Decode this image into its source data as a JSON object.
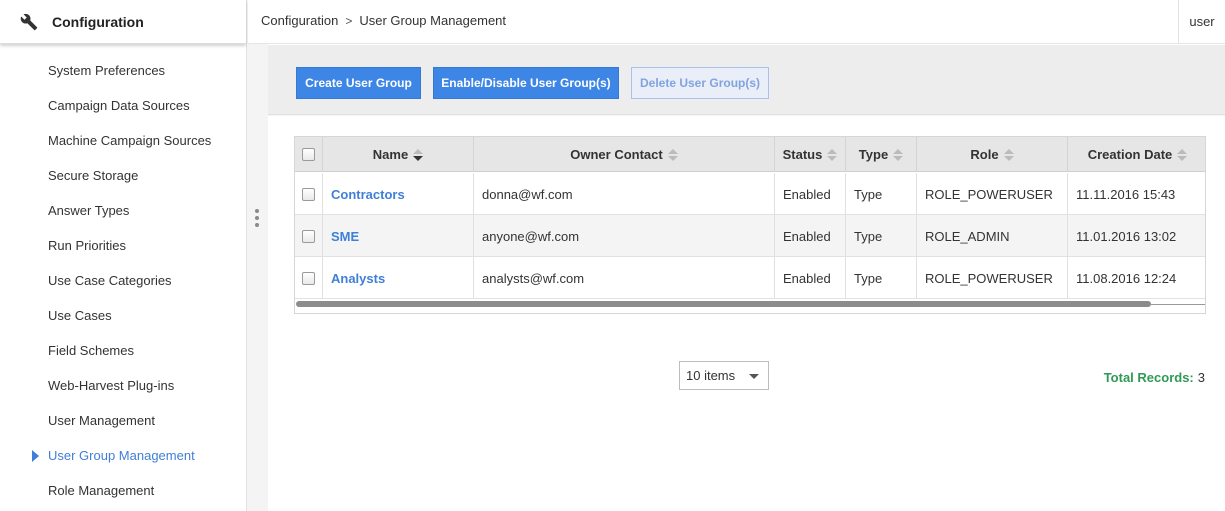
{
  "sidebar": {
    "title": "Configuration",
    "items": [
      {
        "label": "System Preferences",
        "active": false
      },
      {
        "label": "Campaign Data Sources",
        "active": false
      },
      {
        "label": "Machine Campaign Sources",
        "active": false
      },
      {
        "label": "Secure Storage",
        "active": false
      },
      {
        "label": "Answer Types",
        "active": false
      },
      {
        "label": "Run Priorities",
        "active": false
      },
      {
        "label": "Use Case Categories",
        "active": false
      },
      {
        "label": "Use Cases",
        "active": false
      },
      {
        "label": "Field Schemes",
        "active": false
      },
      {
        "label": "Web-Harvest Plug-ins",
        "active": false
      },
      {
        "label": "User Management",
        "active": false
      },
      {
        "label": "User Group Management",
        "active": true
      },
      {
        "label": "Role Management",
        "active": false
      }
    ]
  },
  "header": {
    "breadcrumb": [
      "Configuration",
      "User Group Management"
    ],
    "breadcrumb_separator": ">",
    "user": "user"
  },
  "toolbar": {
    "create_label": "Create User Group",
    "toggle_label": "Enable/Disable User Group(s)",
    "delete_label": "Delete User Group(s)"
  },
  "grid": {
    "columns": {
      "name": "Name",
      "owner": "Owner Contact",
      "status": "Status",
      "type": "Type",
      "role": "Role",
      "created": "Creation Date"
    },
    "rows": [
      {
        "name": "Contractors",
        "owner": "donna@wf.com",
        "status": "Enabled",
        "type": "Type",
        "role": "ROLE_POWERUSER",
        "created": "11.11.2016 15:43"
      },
      {
        "name": "SME",
        "owner": "anyone@wf.com",
        "status": "Enabled",
        "type": "Type",
        "role": "ROLE_ADMIN",
        "created": "11.01.2016 13:02"
      },
      {
        "name": "Analysts",
        "owner": "analysts@wf.com",
        "status": "Enabled",
        "type": "Type",
        "role": "ROLE_POWERUSER",
        "created": "11.08.2016 12:24"
      }
    ]
  },
  "pager": {
    "page_size": "10 items"
  },
  "summary": {
    "total_label": "Total Records:",
    "total_value": "3"
  },
  "colors": {
    "accent": "#3f7fd8",
    "primary_button": "#3d86e6",
    "total_label": "#2f9a55"
  }
}
